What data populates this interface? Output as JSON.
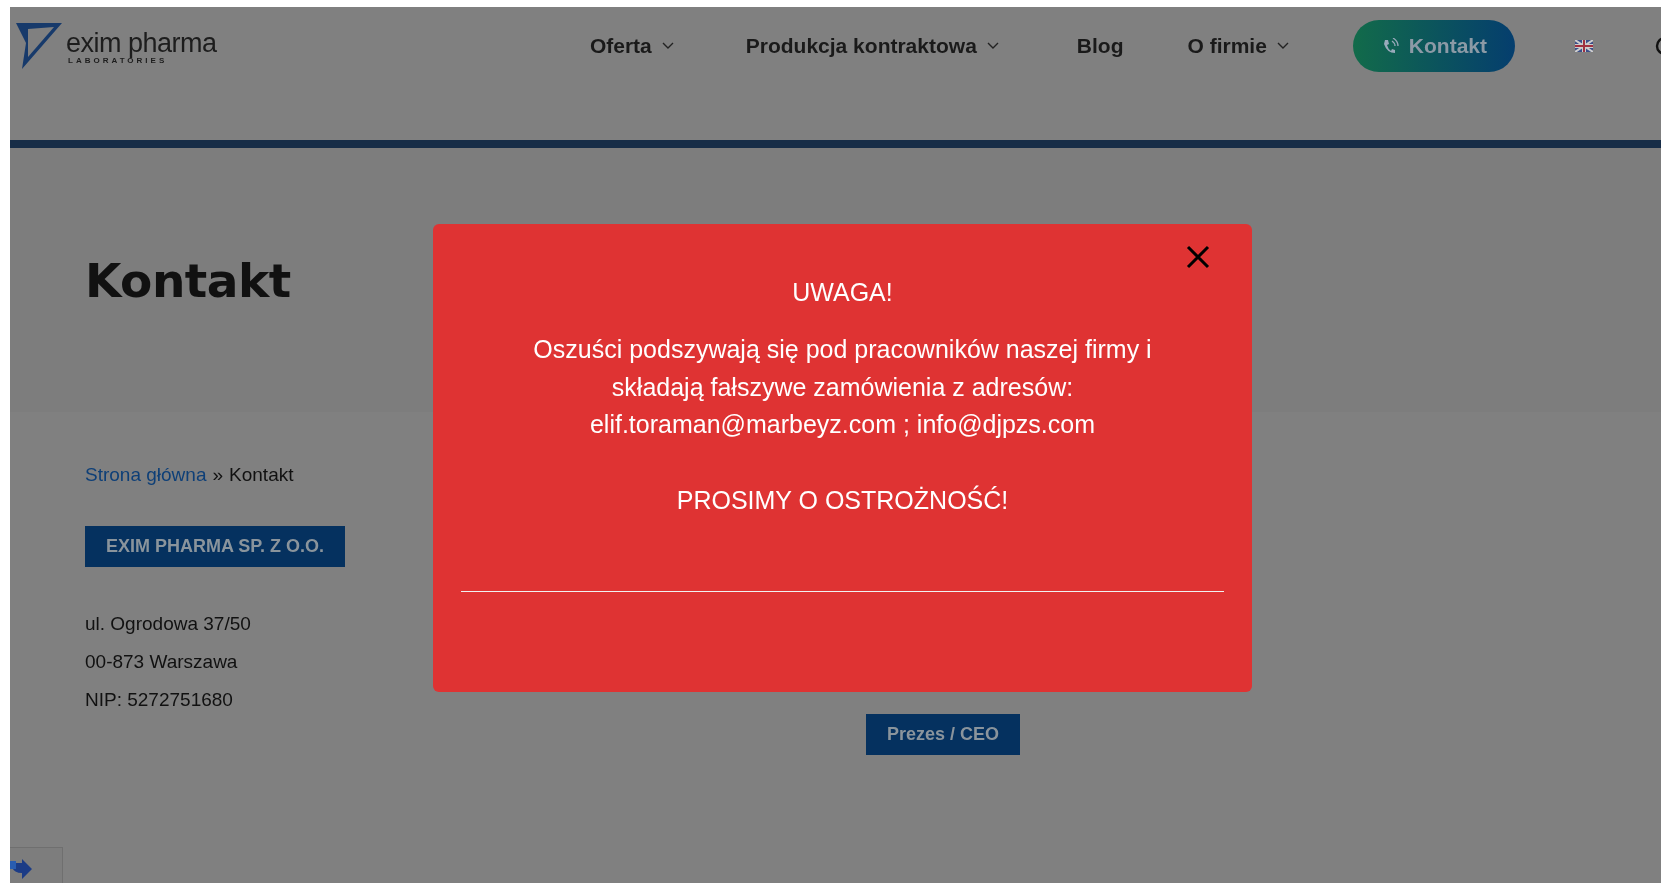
{
  "header": {
    "logo": {
      "name": "exim pharma",
      "tagline": "LABORATORIES"
    },
    "nav": [
      {
        "label": "Oferta",
        "dropdown": true
      },
      {
        "label": "Produkcja kontraktowa",
        "dropdown": true
      },
      {
        "label": "Blog",
        "dropdown": false
      },
      {
        "label": "O firmie",
        "dropdown": true
      }
    ],
    "contact_button": "Kontakt"
  },
  "page_title": "Kontakt",
  "breadcrumb": {
    "link": "Strona główna",
    "separator": "»",
    "current": "Kontakt"
  },
  "company": {
    "name": "EXIM PHARMA SP. Z O.O.",
    "address": [
      "ul. Ogrodowa 37/50",
      "00-873 Warszawa",
      "NIP: 5272751680"
    ]
  },
  "role_badge": "Prezes / CEO",
  "modal": {
    "title": "UWAGA!",
    "message_lines": [
      "Oszuści podszywają się pod pracowników naszej firmy i",
      "składają fałszywe zamówienia z adresów:",
      "elif.toraman@marbeyz.com ; info@djpzs.com"
    ],
    "warning": "PROSIMY O OSTROŻNOŚĆ!"
  }
}
